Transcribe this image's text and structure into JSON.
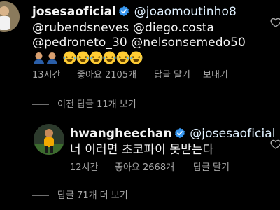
{
  "comment1": {
    "username": "josesaoficial",
    "text_line1_mention": "@joaomoutinho8",
    "text_line2": "@rubendsneves @diego.costa",
    "text_line3_mention": "@pedroneto_30 @nelsonsemedo50",
    "timestamp": "13시간",
    "likes": "좋아요 2105개",
    "reply_label": "답글 달기",
    "send_label": "보내기",
    "emoji_person_count": 2,
    "emoji_laugh_count": 6
  },
  "view_previous_replies": "이전 답글 11개 보기",
  "reply1": {
    "username": "hwangheechan",
    "mention": "@josesaoficial",
    "text": "너 이러면 초코파이 못받는다",
    "timestamp": "12시간",
    "likes": "좋아요 2668개",
    "reply_label": "답글 달기"
  },
  "view_more_replies": "답글 71개 더 보기",
  "colors": {
    "background": "#000000",
    "text": "#f5f5f5",
    "secondary": "#a8a8a8",
    "verified": "#3897f0"
  }
}
